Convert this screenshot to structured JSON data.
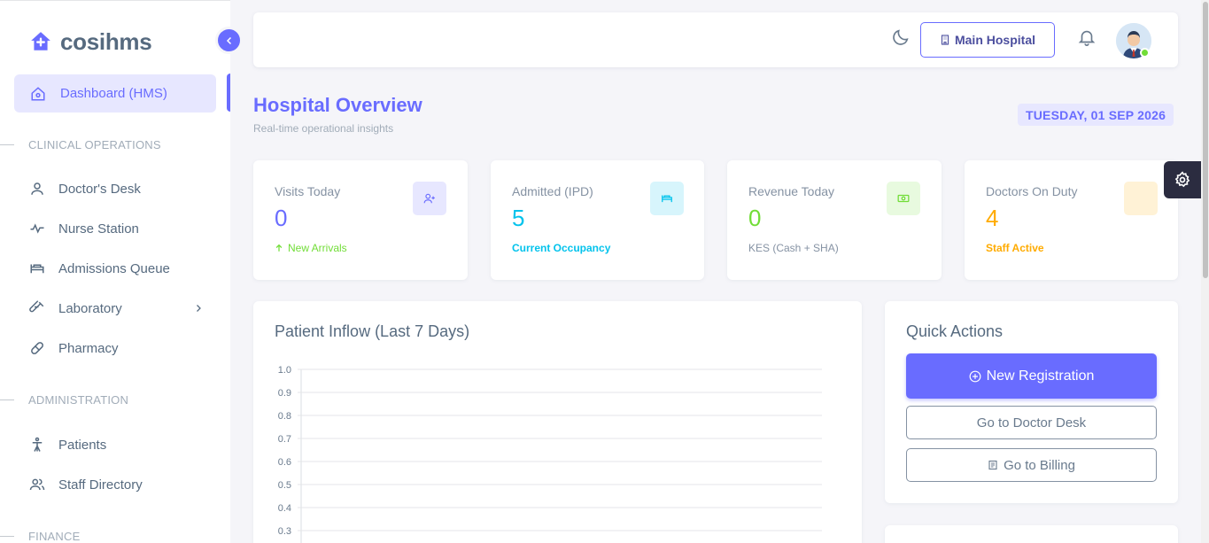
{
  "brand": {
    "name": "cosihms"
  },
  "sidebar": {
    "active": {
      "label": "Dashboard (HMS)"
    },
    "sections": [
      {
        "title": "CLINICAL OPERATIONS"
      },
      {
        "title": "ADMINISTRATION"
      },
      {
        "title": "FINANCE"
      }
    ],
    "items": [
      {
        "label": "Doctor's Desk",
        "icon": "user-icon"
      },
      {
        "label": "Nurse Station",
        "icon": "pulse-icon"
      },
      {
        "label": "Admissions Queue",
        "icon": "bed-icon"
      },
      {
        "label": "Laboratory",
        "icon": "test-tube-icon"
      },
      {
        "label": "Pharmacy",
        "icon": "pill-icon"
      },
      {
        "label": "Patients",
        "icon": "person-icon"
      },
      {
        "label": "Staff Directory",
        "icon": "users-icon"
      }
    ]
  },
  "topbar": {
    "hospital_label": "Main Hospital"
  },
  "header": {
    "title": "Hospital Overview",
    "subtitle": "Real-time operational insights",
    "date": "TUESDAY, 01 SEP 2026"
  },
  "stats": [
    {
      "title": "Visits Today",
      "value": "0",
      "sub": "New Arrivals",
      "color": "#696cff",
      "sub_color": "#71dd37",
      "icon": "user-plus-icon"
    },
    {
      "title": "Admitted (IPD)",
      "value": "5",
      "sub": "Current Occupancy",
      "color": "#03c3ec",
      "sub_color": "#03c3ec",
      "icon": "bed-icon"
    },
    {
      "title": "Revenue Today",
      "value": "0",
      "sub": "KES (Cash + SHA)",
      "color": "#71dd37",
      "sub_color": "#8592a3",
      "icon": "cash-icon"
    },
    {
      "title": "Doctors On Duty",
      "value": "4",
      "sub": "Staff Active",
      "color": "#ffab00",
      "sub_color": "#ffab00",
      "icon": "stethoscope-icon"
    }
  ],
  "chart": {
    "title": "Patient Inflow (Last 7 Days)"
  },
  "chart_data": {
    "type": "line",
    "title": "Patient Inflow (Last 7 Days)",
    "y_ticks": [
      "1.0",
      "0.9",
      "0.8",
      "0.7",
      "0.6",
      "0.5",
      "0.4",
      "0.3"
    ],
    "ylim": [
      0,
      1.0
    ],
    "grid": true,
    "series": []
  },
  "quick_actions": {
    "title": "Quick Actions",
    "new_registration": "New Registration",
    "doctor_desk": "Go to Doctor Desk",
    "billing": "Go to Billing"
  }
}
